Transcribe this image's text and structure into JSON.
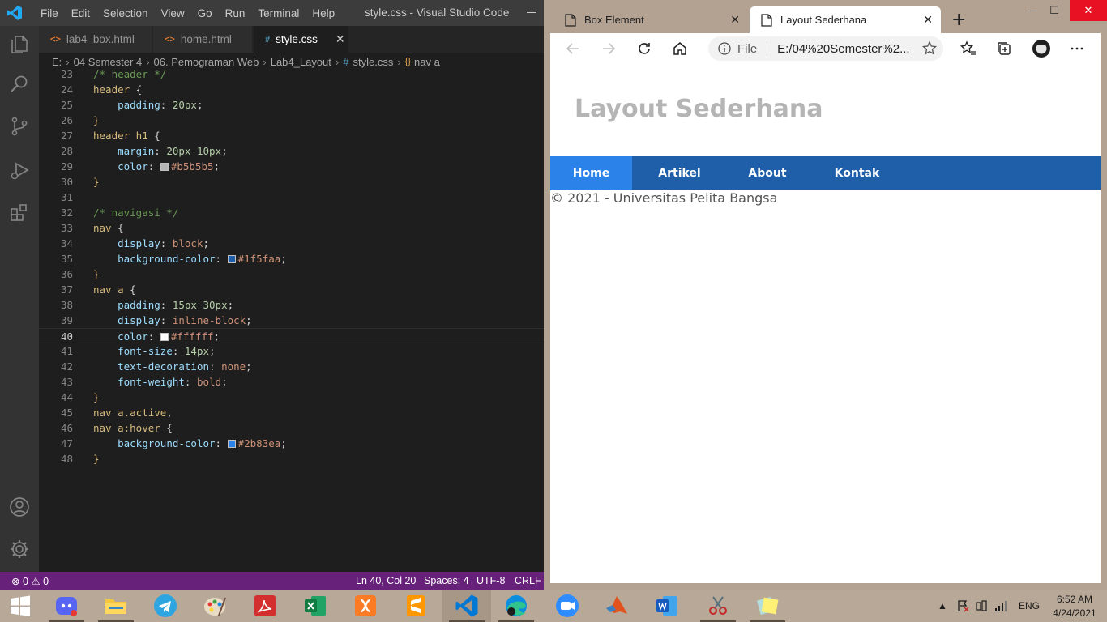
{
  "vscode": {
    "window_title": "style.css - Visual Studio Code",
    "menu": [
      "File",
      "Edit",
      "Selection",
      "View",
      "Go",
      "Run",
      "Terminal",
      "Help"
    ],
    "tabs": [
      {
        "label": "lab4_box.html",
        "icon": "<>"
      },
      {
        "label": "home.html",
        "icon": "<>"
      },
      {
        "label": "style.css",
        "icon": "#",
        "active": true
      }
    ],
    "breadcrumb": [
      "E:",
      "04 Semester 4",
      "06. Pemograman Web",
      "Lab4_Layout",
      "style.css",
      "nav a"
    ],
    "lines": [
      {
        "n": "23",
        "t": "/* header */"
      },
      {
        "n": "24",
        "t": "header {"
      },
      {
        "n": "25",
        "t": "    padding: 20px;"
      },
      {
        "n": "26",
        "t": "}"
      },
      {
        "n": "27",
        "t": "header h1 {"
      },
      {
        "n": "28",
        "t": "    margin: 20px 10px;"
      },
      {
        "n": "29",
        "t": "    color: #b5b5b5;"
      },
      {
        "n": "30",
        "t": "}"
      },
      {
        "n": "31",
        "t": ""
      },
      {
        "n": "32",
        "t": "/* navigasi */"
      },
      {
        "n": "33",
        "t": "nav {"
      },
      {
        "n": "34",
        "t": "    display: block;"
      },
      {
        "n": "35",
        "t": "    background-color: #1f5faa;"
      },
      {
        "n": "36",
        "t": "}"
      },
      {
        "n": "37",
        "t": "nav a {"
      },
      {
        "n": "38",
        "t": "    padding: 15px 30px;"
      },
      {
        "n": "39",
        "t": "    display: inline-block;"
      },
      {
        "n": "40",
        "t": "    color: #ffffff;"
      },
      {
        "n": "41",
        "t": "    font-size: 14px;"
      },
      {
        "n": "42",
        "t": "    text-decoration: none;"
      },
      {
        "n": "43",
        "t": "    font-weight: bold;"
      },
      {
        "n": "44",
        "t": "}"
      },
      {
        "n": "45",
        "t": "nav a.active,"
      },
      {
        "n": "46",
        "t": "nav a:hover {"
      },
      {
        "n": "47",
        "t": "    background-color: #2b83ea;"
      },
      {
        "n": "48",
        "t": "}"
      }
    ],
    "current_line": "40",
    "status": {
      "errors": "0",
      "warnings": "0",
      "position": "Ln 40, Col 20",
      "spaces": "Spaces: 4",
      "encoding": "UTF-8",
      "eol": "CRLF"
    },
    "colors": {
      "status_bar": "#68217a",
      "editor_bg": "#1e1e1e"
    }
  },
  "edge": {
    "tabs": [
      {
        "label": "Box Element"
      },
      {
        "label": "Layout Sederhana",
        "active": true
      }
    ],
    "address_prefix": "File",
    "address": "E:/04%20Semester%2...",
    "page": {
      "heading": "Layout Sederhana",
      "nav": [
        {
          "label": "Home",
          "active": true
        },
        {
          "label": "Artikel"
        },
        {
          "label": "About"
        },
        {
          "label": "Kontak"
        }
      ],
      "footer": "© 2021 - Universitas Pelita Bangsa",
      "colors": {
        "heading": "#b5b5b5",
        "nav_bg": "#1f5faa",
        "nav_active": "#2b83ea"
      }
    }
  },
  "taskbar": {
    "apps": [
      "windows-start",
      "discord",
      "file-explorer",
      "telegram",
      "paint",
      "acrobat",
      "excel",
      "xampp",
      "sublime-text",
      "vscode",
      "edge",
      "zoom",
      "matlab",
      "word",
      "snipping-tool",
      "sticky-notes"
    ],
    "language": "ENG",
    "time": "6:52 AM",
    "date": "4/24/2021"
  }
}
